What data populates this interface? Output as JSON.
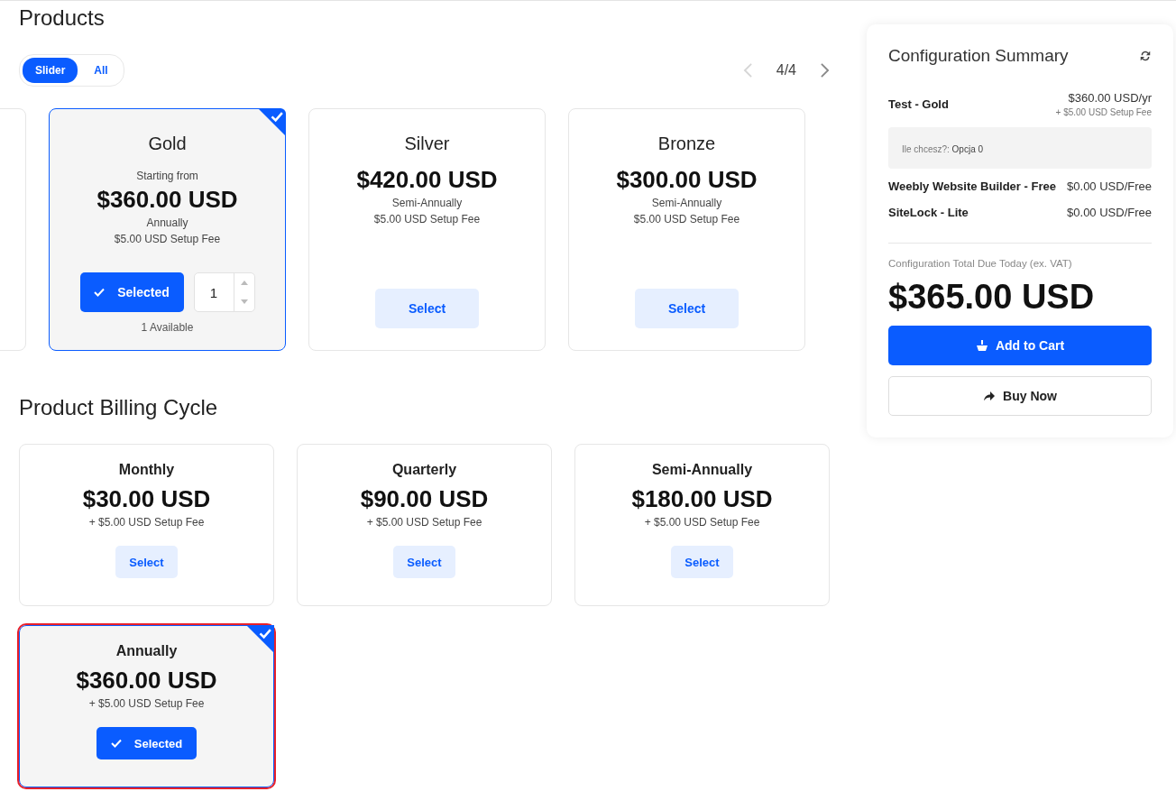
{
  "products_heading": "Products",
  "view_toggle": [
    {
      "label": "Slider",
      "selected": true
    },
    {
      "label": "All",
      "selected": false
    }
  ],
  "pager": {
    "text": "4/4",
    "prev_disabled": true,
    "next_disabled": false
  },
  "products": [
    {
      "kind": "partial",
      "selected": false
    },
    {
      "kind": "full",
      "name": "Gold",
      "starting_label": "Starting from",
      "price": "$360.00 USD",
      "cycle": "Annually",
      "setup_fee": "$5.00 USD Setup Fee",
      "selected": true,
      "button": "Selected",
      "quantity": "1",
      "availability": "1 Available"
    },
    {
      "kind": "full",
      "name": "Silver",
      "price": "$420.00 USD",
      "cycle": "Semi-Annually",
      "setup_fee": "$5.00 USD Setup Fee",
      "selected": false,
      "button": "Select"
    },
    {
      "kind": "full",
      "name": "Bronze",
      "price": "$300.00 USD",
      "cycle": "Semi-Annually",
      "setup_fee": "$5.00 USD Setup Fee",
      "selected": false,
      "button": "Select"
    }
  ],
  "billing_heading": "Product Billing Cycle",
  "billing_cycles": [
    {
      "name": "Monthly",
      "price": "$30.00 USD",
      "setup_fee": "+ $5.00 USD Setup Fee",
      "selected": false,
      "highlighted": false,
      "button": "Select"
    },
    {
      "name": "Quarterly",
      "price": "$90.00 USD",
      "setup_fee": "+ $5.00 USD Setup Fee",
      "selected": false,
      "highlighted": false,
      "button": "Select"
    },
    {
      "name": "Semi-Annually",
      "price": "$180.00 USD",
      "setup_fee": "+ $5.00 USD Setup Fee",
      "selected": false,
      "highlighted": false,
      "button": "Select"
    },
    {
      "name": "Annually",
      "price": "$360.00 USD",
      "setup_fee": "+ $5.00 USD Setup Fee",
      "selected": true,
      "highlighted": true,
      "button": "Selected"
    }
  ],
  "summary": {
    "title": "Configuration Summary",
    "main_item": {
      "name": "Test - Gold",
      "price": "$360.00 USD/yr",
      "setup_fee": "+ $5.00 USD Setup Fee"
    },
    "option": {
      "label": "Ile chcesz?:",
      "value": "Opcja 0"
    },
    "addons": [
      {
        "name": "Weebly Website Builder - Free",
        "price": "$0.00 USD/Free"
      },
      {
        "name": "SiteLock - Lite",
        "price": "$0.00 USD/Free"
      }
    ],
    "total_label": "Configuration Total Due Today (ex. VAT)",
    "total": "$365.00 USD",
    "add_to_cart": "Add to Cart",
    "buy_now": "Buy Now"
  }
}
